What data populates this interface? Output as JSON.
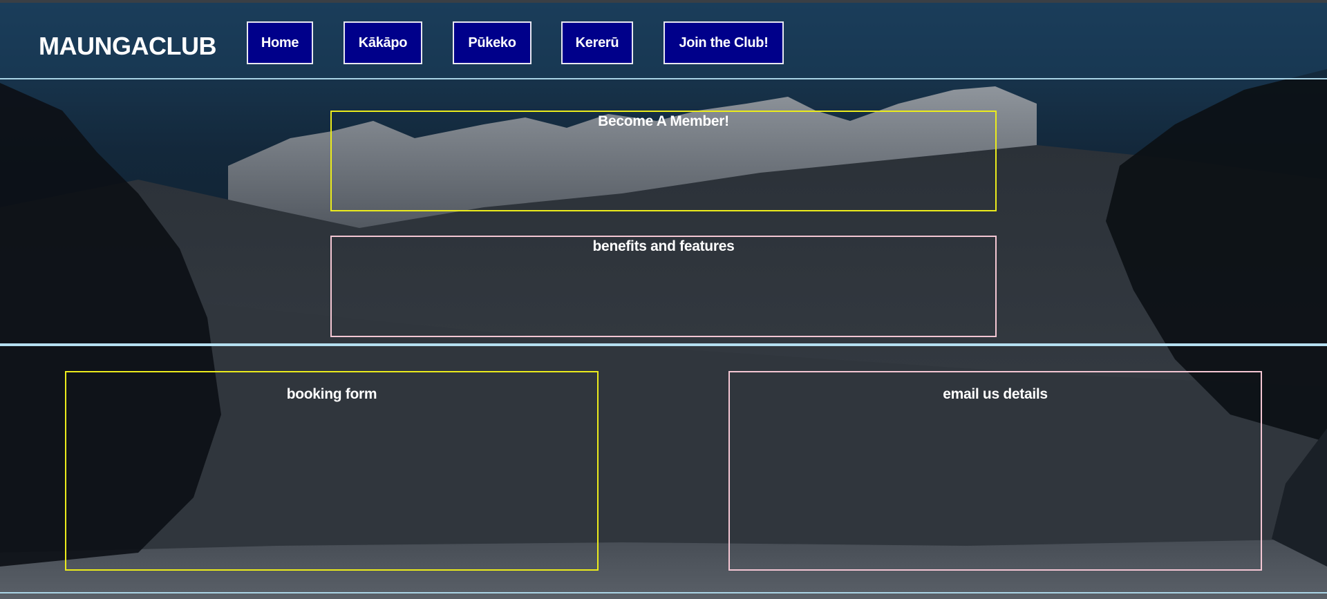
{
  "brand": {
    "logo_text": "MAUNGACLUB",
    "colors": {
      "nav_bg": "#00008a",
      "nav_border": "#e8e8f0",
      "accent_yellow": "#ecec1c",
      "accent_pink": "#f5c7d4",
      "rule_blue": "#aad4e6"
    }
  },
  "nav": {
    "items": [
      {
        "label": "Home"
      },
      {
        "label": "Kākāpo"
      },
      {
        "label": "Pūkeko"
      },
      {
        "label": "Kererū"
      },
      {
        "label": "Join the Club!"
      }
    ]
  },
  "main": {
    "member_title": "Become A Member!",
    "benefits_title": "benefits and features"
  },
  "lower": {
    "booking_title": "booking form",
    "email_title": "email us details"
  }
}
